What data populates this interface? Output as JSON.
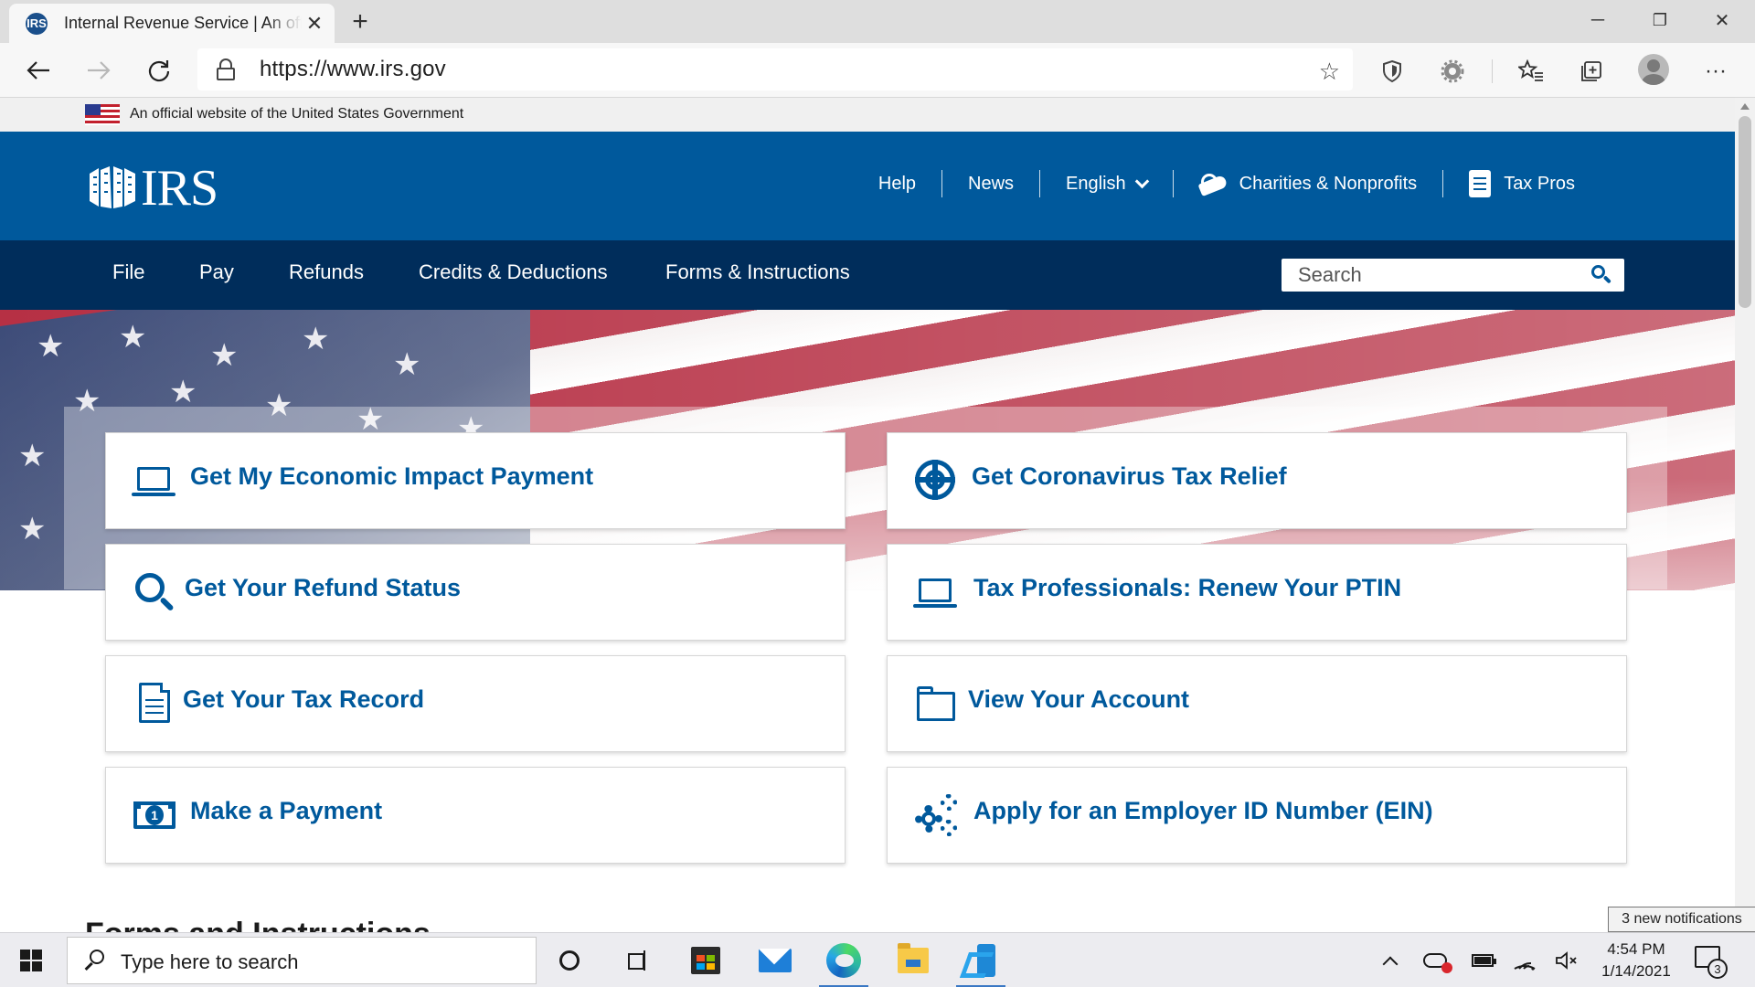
{
  "browser": {
    "tab_title": "Internal Revenue Service | An official site of the United States government",
    "tab_favicon_text": "IRS",
    "new_tab_symbol": "+",
    "url": "https://www.irs.gov",
    "window_controls": {
      "minimize": "─",
      "restore": "❐",
      "close": "✕"
    }
  },
  "gov_banner": {
    "text": "An official website of the United States Government"
  },
  "header": {
    "logo_text": "IRS",
    "utility_nav": [
      {
        "label": "Help"
      },
      {
        "label": "News"
      },
      {
        "label": "English"
      },
      {
        "label": "Charities & Nonprofits"
      },
      {
        "label": "Tax Pros"
      }
    ]
  },
  "main_nav": {
    "items": [
      {
        "label": "File"
      },
      {
        "label": "Pay"
      },
      {
        "label": "Refunds"
      },
      {
        "label": "Credits & Deductions"
      },
      {
        "label": "Forms & Instructions"
      }
    ],
    "search_placeholder": "Search"
  },
  "cards": [
    {
      "label": "Get My Economic Impact Payment",
      "icon": "laptop-icon"
    },
    {
      "label": "Get Coronavirus Tax Relief",
      "icon": "lifebuoy-icon"
    },
    {
      "label": "Get Your Refund Status",
      "icon": "magnifier-icon"
    },
    {
      "label": "Tax Professionals: Renew Your PTIN",
      "icon": "laptop-icon"
    },
    {
      "label": "Get Your Tax Record",
      "icon": "file-icon"
    },
    {
      "label": "View Your Account",
      "icon": "folder-icon"
    },
    {
      "label": "Make a Payment",
      "icon": "money-icon"
    },
    {
      "label": "Apply for an Employer ID Number (EIN)",
      "icon": "gears-icon"
    }
  ],
  "section_heading": "Forms and Instructions",
  "notification_tooltip": "3 new notifications",
  "taskbar": {
    "search_placeholder": "Type here to search",
    "money_icon_symbol": "1",
    "time": "4:54 PM",
    "date": "1/14/2021",
    "notification_count": "3"
  },
  "colors": {
    "irs_blue": "#00599c",
    "irs_navy": "#002d5b",
    "card_text": "#00599c"
  }
}
